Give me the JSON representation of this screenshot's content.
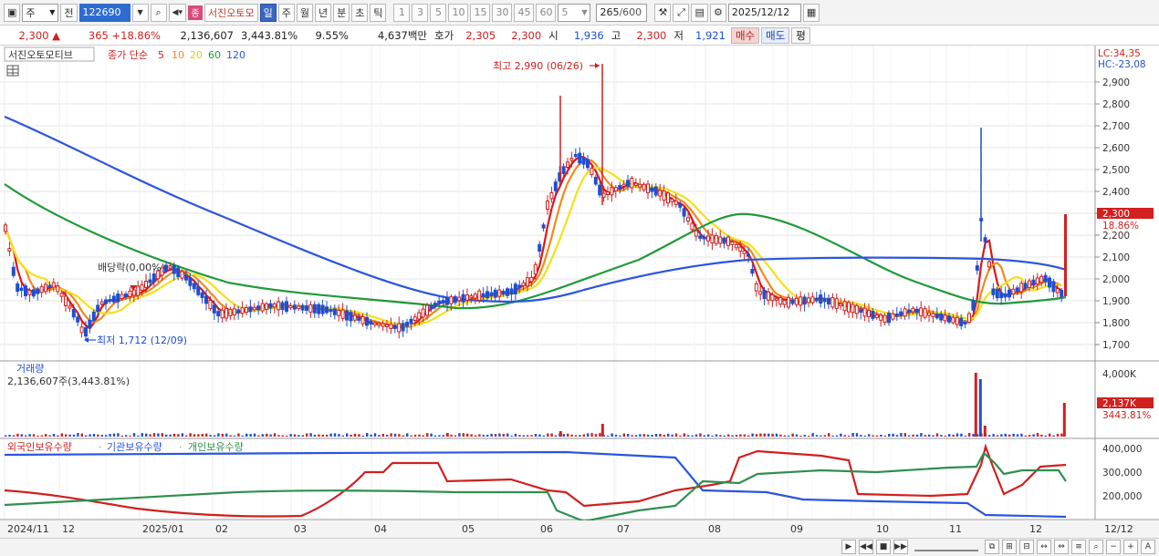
{
  "toolbar": {
    "market": "주",
    "prev_label": "전",
    "code": "122690",
    "stock_name": "서진오토모",
    "jong_badge": "종",
    "periods": [
      "일",
      "주",
      "월",
      "년",
      "분",
      "초",
      "틱"
    ],
    "active_period": "일",
    "minute_steps": [
      "1",
      "3",
      "5",
      "10",
      "15",
      "30",
      "45",
      "60"
    ],
    "step_value": "5",
    "count_value": "265",
    "count_total": "/600",
    "date_value": "2025/12/12"
  },
  "infobar": {
    "price": "2,300",
    "change_arrow": "▲",
    "change": "365",
    "change_pct": "+18.86%",
    "volume": "2,136,607",
    "volume_pct": "3,443.81%",
    "turnover": "9.55%",
    "amount": "4,637백만",
    "quote_label": "호가",
    "ask": "2,305",
    "bid": "2,300",
    "open_label": "시",
    "open": "1,936",
    "high_label": "고",
    "high": "2,300",
    "low_label": "저",
    "low": "1,921",
    "buy_label": "매수",
    "sell_label": "매도",
    "eval_label": "평"
  },
  "legend": {
    "stock": "서진오토모티브",
    "ma_label": "종가 단순",
    "ma_periods": [
      "5",
      "10",
      "20",
      "60",
      "120"
    ],
    "lc": "LC:34,35",
    "hc": "HC:-23,08"
  },
  "annotations": {
    "high": "최고 2,990 (06/26)",
    "low": "최저 1,712 (12/09)",
    "dividend": "배당락(0,00%)"
  },
  "price_axis": [
    "2,900",
    "2,800",
    "2,700",
    "2,600",
    "2,500",
    "2,400",
    "2,300",
    "2,200",
    "2,100",
    "2,000",
    "1,900",
    "1,800",
    "1,700"
  ],
  "current_price_tag": "2,300",
  "current_change_tag": "18.86%",
  "volume_panel": {
    "title": "거래량",
    "value": "2,136,607주(3,443.81%)",
    "axis": [
      "4,000K"
    ],
    "tag": "2,137K",
    "tag_pct": "3443.81%"
  },
  "holdings_panel": {
    "series_labels": [
      "외국인보유수량",
      "기관보유수량",
      "개인보유수량"
    ],
    "axis": [
      "400,000",
      "300,000",
      "200,000"
    ]
  },
  "time_axis": [
    "2024/11",
    "12",
    "2025/01",
    "02",
    "03",
    "04",
    "05",
    "06",
    "07",
    "08",
    "09",
    "10",
    "11",
    "12"
  ],
  "time_axis_right": "12/12",
  "colors": {
    "price_up": "#d21f1f",
    "price_down": "#1f4fd2",
    "ma5": "#e01515",
    "ma10": "#f08a1c",
    "ma20": "#f2e11a",
    "ma60": "#1f9a3a",
    "ma120": "#2b55e0",
    "foreign": "#d21f1f",
    "institution": "#2b55e0",
    "individual": "#2f8f4f"
  }
}
